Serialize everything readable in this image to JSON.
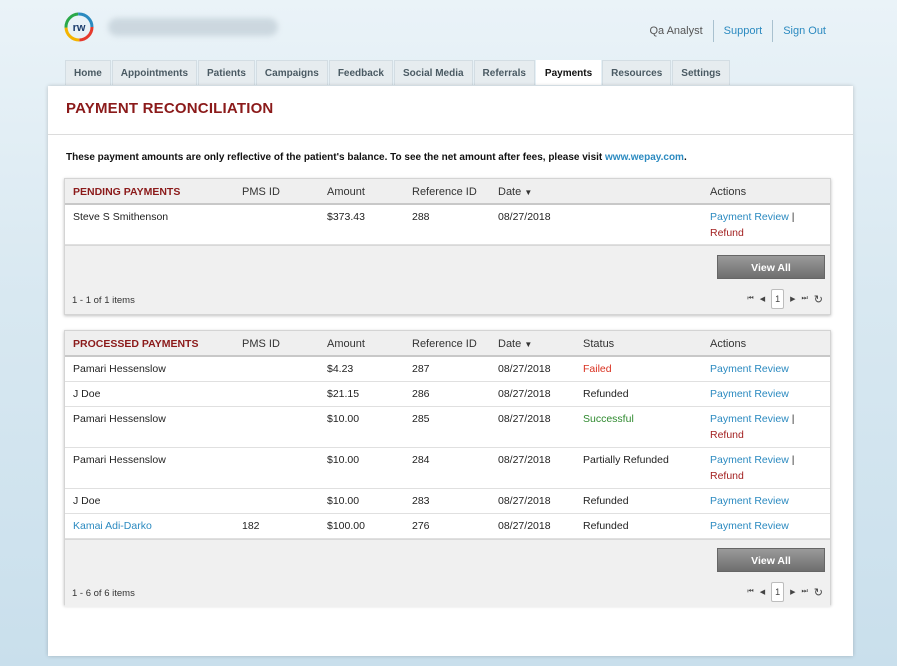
{
  "header": {
    "user": "Qa Analyst",
    "support": "Support",
    "signout": "Sign Out"
  },
  "tabs": [
    {
      "label": "Home"
    },
    {
      "label": "Appointments"
    },
    {
      "label": "Patients"
    },
    {
      "label": "Campaigns"
    },
    {
      "label": "Feedback"
    },
    {
      "label": "Social Media"
    },
    {
      "label": "Referrals"
    },
    {
      "label": "Payments",
      "active": true
    },
    {
      "label": "Resources"
    },
    {
      "label": "Settings"
    }
  ],
  "page": {
    "title": "PAYMENT RECONCILIATION",
    "notice_text": "These payment amounts are only reflective of the patient's balance. To see the net amount after fees, please visit ",
    "notice_link": "www.wepay.com",
    "notice_end": "."
  },
  "pending": {
    "title": "PENDING PAYMENTS",
    "columns": {
      "pms": "PMS ID",
      "amount": "Amount",
      "ref": "Reference ID",
      "date": "Date",
      "actions": "Actions"
    },
    "sort_icon": "▼",
    "rows": [
      {
        "name": "Steve S Smithenson",
        "pms": "",
        "amount": "$373.43",
        "ref": "288",
        "date": "08/27/2018",
        "review": "Payment Review",
        "pipe": "|",
        "refund": "Refund"
      }
    ],
    "view_all": "View All",
    "count": "1 - 1 of 1 items",
    "page": "1"
  },
  "processed": {
    "title": "PROCESSED PAYMENTS",
    "columns": {
      "pms": "PMS ID",
      "amount": "Amount",
      "ref": "Reference ID",
      "date": "Date",
      "status": "Status",
      "actions": "Actions"
    },
    "sort_icon": "▼",
    "rows": [
      {
        "name": "Pamari Hessenslow",
        "pms": "",
        "amount": "$4.23",
        "ref": "287",
        "date": "08/27/2018",
        "status": "Failed",
        "review": "Payment Review"
      },
      {
        "name": "J Doe",
        "pms": "",
        "amount": "$21.15",
        "ref": "286",
        "date": "08/27/2018",
        "status": "Refunded",
        "review": "Payment Review"
      },
      {
        "name": "Pamari Hessenslow",
        "pms": "",
        "amount": "$10.00",
        "ref": "285",
        "date": "08/27/2018",
        "status": "Successful",
        "review": "Payment Review",
        "pipe": "|",
        "refund": "Refund"
      },
      {
        "name": "Pamari Hessenslow",
        "pms": "",
        "amount": "$10.00",
        "ref": "284",
        "date": "08/27/2018",
        "status": "Partially Refunded",
        "review": "Payment Review",
        "pipe": "|",
        "refund": "Refund"
      },
      {
        "name": "J Doe",
        "pms": "",
        "amount": "$10.00",
        "ref": "283",
        "date": "08/27/2018",
        "status": "Refunded",
        "review": "Payment Review"
      },
      {
        "name": "Kamai Adi-Darko",
        "pms": "182",
        "amount": "$100.00",
        "ref": "276",
        "date": "08/27/2018",
        "status": "Refunded",
        "review": "Payment Review"
      }
    ],
    "view_all": "View All",
    "count": "1 - 6 of 6 items",
    "page": "1"
  },
  "pager_icons": {
    "first": "⏮",
    "prev": "◀",
    "next": "▶",
    "last": "⏭",
    "refresh": "↻"
  },
  "colors": {
    "title": "#8b1a1a",
    "link": "#2b8ac0",
    "failed": "#d9301f",
    "successful": "#2f8a2f",
    "refund": "#a32121"
  }
}
